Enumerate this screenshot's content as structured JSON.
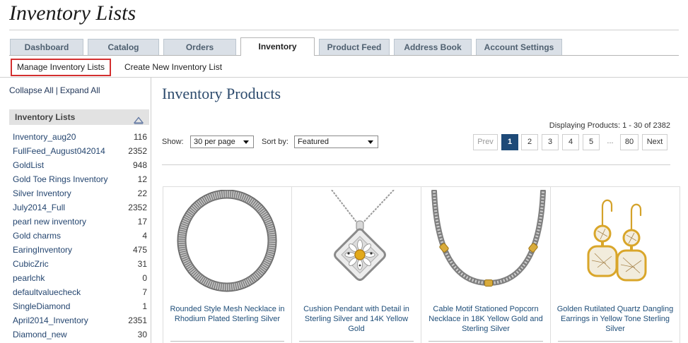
{
  "page": {
    "title": "Inventory Lists"
  },
  "tabs": [
    {
      "label": "Dashboard",
      "active": false
    },
    {
      "label": "Catalog",
      "active": false
    },
    {
      "label": "Orders",
      "active": false
    },
    {
      "label": "Inventory",
      "active": true
    },
    {
      "label": "Product Feed",
      "active": false
    },
    {
      "label": "Address Book",
      "active": false
    },
    {
      "label": "Account Settings",
      "active": false
    }
  ],
  "subnav": {
    "items": [
      {
        "label": "Manage Inventory Lists",
        "highlighted": true
      },
      {
        "label": "Create New Inventory List",
        "highlighted": false
      }
    ]
  },
  "sidebar": {
    "collapse_all": "Collapse All",
    "separator": "|",
    "expand_all": "Expand All",
    "header": "Inventory Lists",
    "header_icon": "triangle-up-icon",
    "items": [
      {
        "name": "Inventory_aug20",
        "count": "116"
      },
      {
        "name": "FullFeed_August042014",
        "count": "2352"
      },
      {
        "name": "GoldList",
        "count": "948"
      },
      {
        "name": "Gold Toe Rings Inventory",
        "count": "12"
      },
      {
        "name": "Silver Inventory",
        "count": "22"
      },
      {
        "name": "July2014_Full",
        "count": "2352"
      },
      {
        "name": "pearl new inventory",
        "count": "17"
      },
      {
        "name": "Gold charms",
        "count": "4"
      },
      {
        "name": "EaringInventory",
        "count": "475"
      },
      {
        "name": "CubicZric",
        "count": "31"
      },
      {
        "name": "pearlchk",
        "count": "0"
      },
      {
        "name": "defaultvaluecheck",
        "count": "7"
      },
      {
        "name": "SingleDiamond",
        "count": "1"
      },
      {
        "name": "April2014_Inventory",
        "count": "2351"
      },
      {
        "name": "Diamond_new",
        "count": "30"
      }
    ]
  },
  "main": {
    "heading": "Inventory Products",
    "displaying": "Displaying Products: 1 - 30 of 2382",
    "show_label": "Show:",
    "per_page": "30 per page",
    "sort_label": "Sort by:",
    "sort_value": "Featured",
    "select_icon": "chevron-down-icon",
    "pagination": {
      "prev": "Prev",
      "pages": [
        {
          "label": "1",
          "active": true
        },
        {
          "label": "2",
          "active": false
        },
        {
          "label": "3",
          "active": false
        },
        {
          "label": "4",
          "active": false
        },
        {
          "label": "5",
          "active": false
        }
      ],
      "ellipsis": "...",
      "last": "80",
      "next": "Next"
    }
  },
  "products": [
    {
      "name": "Rounded Style Mesh Necklace in Rhodium Plated Sterling Silver"
    },
    {
      "name": "Cushion Pendant with Detail in Sterling Silver and 14K Yellow Gold"
    },
    {
      "name": "Cable Motif Stationed Popcorn Necklace in 18K Yellow Gold and Sterling Silver"
    },
    {
      "name": "Golden Rutilated Quartz Dangling Earrings in Yellow Tone Sterling Silver"
    }
  ],
  "colors": {
    "accent": "#1e4a78",
    "link": "#1f4e79",
    "highlight_border": "#d32f2f",
    "tab_background": "#dae0e7",
    "heading": "#2d4b6d"
  }
}
